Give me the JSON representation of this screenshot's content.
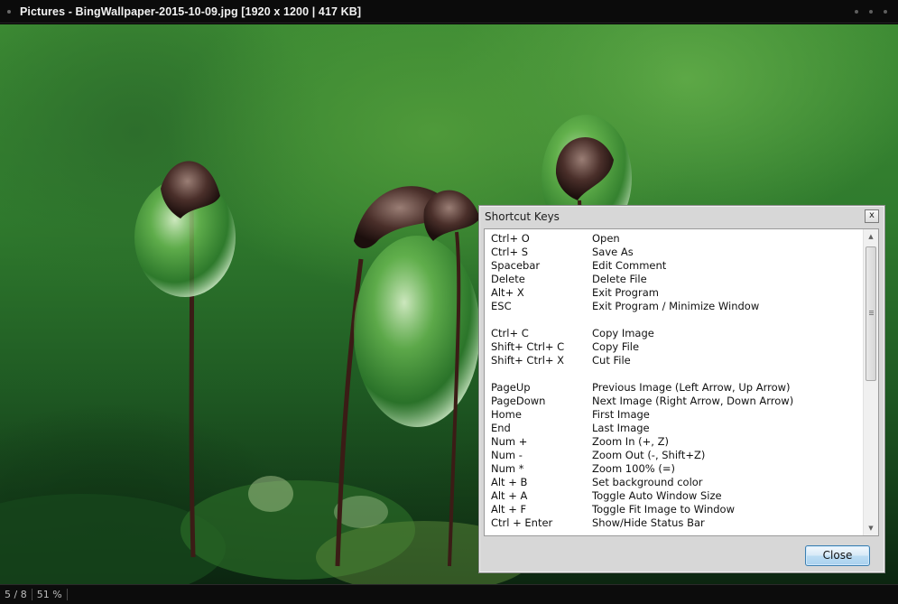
{
  "window": {
    "title": "Pictures - BingWallpaper-2015-10-09.jpg   [1920 x 1200   |   417 KB]"
  },
  "dialog": {
    "title": "Shortcut Keys",
    "close_x": "x",
    "close_button": "Close",
    "shortcuts": [
      {
        "key": "Ctrl+ O",
        "action": "Open"
      },
      {
        "key": "Ctrl+ S",
        "action": "Save As"
      },
      {
        "key": "Spacebar",
        "action": "Edit Comment"
      },
      {
        "key": "Delete",
        "action": "Delete File"
      },
      {
        "key": "Alt+ X",
        "action": "Exit Program"
      },
      {
        "key": "ESC",
        "action": "Exit Program / Minimize Window"
      },
      {
        "key": "",
        "action": ""
      },
      {
        "key": "Ctrl+ C",
        "action": "Copy Image"
      },
      {
        "key": "Shift+ Ctrl+ C",
        "action": "Copy File"
      },
      {
        "key": "Shift+ Ctrl+ X",
        "action": "Cut File"
      },
      {
        "key": "",
        "action": ""
      },
      {
        "key": "PageUp",
        "action": "Previous Image (Left Arrow, Up Arrow)"
      },
      {
        "key": "PageDown",
        "action": "Next Image (Right Arrow, Down Arrow)"
      },
      {
        "key": "Home",
        "action": "First Image"
      },
      {
        "key": "End",
        "action": "Last Image"
      },
      {
        "key": "Num +",
        "action": "Zoom In (+, Z)"
      },
      {
        "key": "Num -",
        "action": "Zoom Out (-, Shift+Z)"
      },
      {
        "key": "Num *",
        "action": "Zoom 100% (=)"
      },
      {
        "key": "Alt + B",
        "action": "Set background color"
      },
      {
        "key": "Alt + A",
        "action": "Toggle Auto Window Size"
      },
      {
        "key": "Alt + F",
        "action": "Toggle Fit Image to Window"
      },
      {
        "key": "Ctrl + Enter",
        "action": "Show/Hide Status Bar"
      }
    ]
  },
  "status": {
    "position": "5 / 8",
    "zoom": "51 %"
  },
  "colors": {
    "accent_button_border": "#3c7fb1",
    "titlebar_bg": "#0b0b0b"
  }
}
